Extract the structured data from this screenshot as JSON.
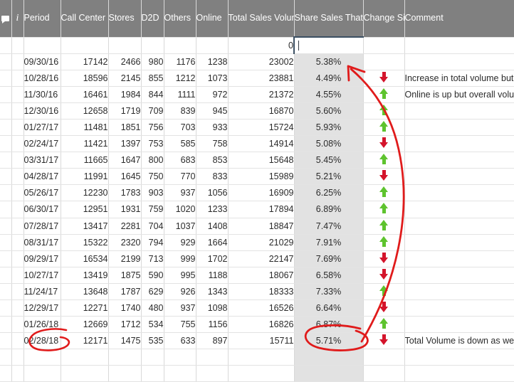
{
  "header": {
    "columns": [
      {
        "key": "mark",
        "label": "",
        "icon": "comment-bubble-icon"
      },
      {
        "key": "info",
        "label": "",
        "icon": "info-icon"
      },
      {
        "key": "period",
        "label": "Period"
      },
      {
        "key": "call",
        "label": "Call Center"
      },
      {
        "key": "stores",
        "label": "Stores"
      },
      {
        "key": "d2d",
        "label": "D2D"
      },
      {
        "key": "others",
        "label": "Others"
      },
      {
        "key": "online",
        "label": "Online"
      },
      {
        "key": "total",
        "label": "Total Sales Volume"
      },
      {
        "key": "share",
        "label": "Share Sales That Are On Line"
      },
      {
        "key": "change",
        "label": "Change Since Last Period"
      },
      {
        "key": "comment",
        "label": "Comment"
      }
    ]
  },
  "selection": {
    "column": "Share Sales That Are On Line",
    "row_index": 0,
    "value": "",
    "editing": true,
    "border_color": "#3c5063"
  },
  "colors": {
    "header_background": "#808080",
    "header_text": "#ffffff",
    "highlight_column": "#e2e2e2",
    "arrow_up": "#5ec32e",
    "arrow_down": "#d4142b",
    "annotation": "#e01b1b",
    "grid_line": "#d9d9d9"
  },
  "rows": [
    {
      "period": "",
      "call": "",
      "stores": "",
      "d2d": "",
      "others": "",
      "online": "",
      "total": "0",
      "share": "",
      "change": "",
      "comment": "",
      "selected": true
    },
    {
      "period": "09/30/16",
      "call": "17142",
      "stores": "2466",
      "d2d": "980",
      "others": "1176",
      "online": "1238",
      "total": "23002",
      "share": "5.38%",
      "change": "",
      "comment": ""
    },
    {
      "period": "10/28/16",
      "call": "18596",
      "stores": "2145",
      "d2d": "855",
      "others": "1212",
      "online": "1073",
      "total": "23881",
      "share": "4.49%",
      "change": "down",
      "comment": "Increase in total volume but dec"
    },
    {
      "period": "11/30/16",
      "call": "16461",
      "stores": "1984",
      "d2d": "844",
      "others": "1111",
      "online": "972",
      "total": "21372",
      "share": "4.55%",
      "change": "up",
      "comment": "Online is up but overall volume "
    },
    {
      "period": "12/30/16",
      "call": "12658",
      "stores": "1719",
      "d2d": "709",
      "others": "839",
      "online": "945",
      "total": "16870",
      "share": "5.60%",
      "change": "up",
      "comment": ""
    },
    {
      "period": "01/27/17",
      "call": "11481",
      "stores": "1851",
      "d2d": "756",
      "others": "703",
      "online": "933",
      "total": "15724",
      "share": "5.93%",
      "change": "up",
      "comment": ""
    },
    {
      "period": "02/24/17",
      "call": "11421",
      "stores": "1397",
      "d2d": "753",
      "others": "585",
      "online": "758",
      "total": "14914",
      "share": "5.08%",
      "change": "down",
      "comment": ""
    },
    {
      "period": "03/31/17",
      "call": "11665",
      "stores": "1647",
      "d2d": "800",
      "others": "683",
      "online": "853",
      "total": "15648",
      "share": "5.45%",
      "change": "up",
      "comment": ""
    },
    {
      "period": "04/28/17",
      "call": "11991",
      "stores": "1645",
      "d2d": "750",
      "others": "770",
      "online": "833",
      "total": "15989",
      "share": "5.21%",
      "change": "down",
      "comment": ""
    },
    {
      "period": "05/26/17",
      "call": "12230",
      "stores": "1783",
      "d2d": "903",
      "others": "937",
      "online": "1056",
      "total": "16909",
      "share": "6.25%",
      "change": "up",
      "comment": ""
    },
    {
      "period": "06/30/17",
      "call": "12951",
      "stores": "1931",
      "d2d": "759",
      "others": "1020",
      "online": "1233",
      "total": "17894",
      "share": "6.89%",
      "change": "up",
      "comment": ""
    },
    {
      "period": "07/28/17",
      "call": "13417",
      "stores": "2281",
      "d2d": "704",
      "others": "1037",
      "online": "1408",
      "total": "18847",
      "share": "7.47%",
      "change": "up",
      "comment": ""
    },
    {
      "period": "08/31/17",
      "call": "15322",
      "stores": "2320",
      "d2d": "794",
      "others": "929",
      "online": "1664",
      "total": "21029",
      "share": "7.91%",
      "change": "up",
      "comment": ""
    },
    {
      "period": "09/29/17",
      "call": "16534",
      "stores": "2199",
      "d2d": "713",
      "others": "999",
      "online": "1702",
      "total": "22147",
      "share": "7.69%",
      "change": "down",
      "comment": ""
    },
    {
      "period": "10/27/17",
      "call": "13419",
      "stores": "1875",
      "d2d": "590",
      "others": "995",
      "online": "1188",
      "total": "18067",
      "share": "6.58%",
      "change": "down",
      "comment": ""
    },
    {
      "period": "11/24/17",
      "call": "13648",
      "stores": "1787",
      "d2d": "629",
      "others": "926",
      "online": "1343",
      "total": "18333",
      "share": "7.33%",
      "change": "up",
      "comment": ""
    },
    {
      "period": "12/29/17",
      "call": "12271",
      "stores": "1740",
      "d2d": "480",
      "others": "937",
      "online": "1098",
      "total": "16526",
      "share": "6.64%",
      "change": "down",
      "comment": ""
    },
    {
      "period": "01/26/18",
      "call": "12669",
      "stores": "1712",
      "d2d": "534",
      "others": "755",
      "online": "1156",
      "total": "16826",
      "share": "6.87%",
      "change": "up",
      "comment": ""
    },
    {
      "period": "02/28/18",
      "call": "12171",
      "stores": "1475",
      "d2d": "535",
      "others": "633",
      "online": "897",
      "total": "15711",
      "share": "5.71%",
      "change": "down",
      "comment": "Total Volume is down as well as"
    },
    {
      "period": "",
      "call": "",
      "stores": "",
      "d2d": "",
      "others": "",
      "online": "",
      "total": "",
      "share": "",
      "change": "",
      "comment": ""
    },
    {
      "period": "",
      "call": "",
      "stores": "",
      "d2d": "",
      "others": "",
      "online": "",
      "total": "",
      "share": "",
      "change": "",
      "comment": ""
    }
  ],
  "annotations": [
    {
      "name": "ellipse-around-last-period",
      "shape": "ellipse",
      "target": "02/28/18"
    },
    {
      "name": "ellipse-around-last-share",
      "shape": "ellipse",
      "target": "5.71%"
    },
    {
      "name": "arrow-to-selected-cell",
      "shape": "arrow",
      "target": "Share Sales That Are On Line"
    }
  ]
}
